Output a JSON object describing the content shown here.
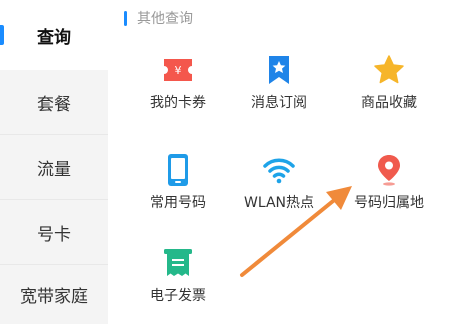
{
  "sidebar": {
    "items": [
      {
        "label": "查询"
      },
      {
        "label": "套餐"
      },
      {
        "label": "流量"
      },
      {
        "label": "号卡"
      },
      {
        "label": "宽带家庭"
      }
    ]
  },
  "main": {
    "section_title": "其他查询",
    "items": [
      {
        "label": "我的卡券",
        "icon": "coupon-icon"
      },
      {
        "label": "消息订阅",
        "icon": "bookmark-star-icon"
      },
      {
        "label": "商品收藏",
        "icon": "star-icon"
      },
      {
        "label": "常用号码",
        "icon": "phone-icon"
      },
      {
        "label": "WLAN热点",
        "icon": "wifi-icon"
      },
      {
        "label": "号码归属地",
        "icon": "location-pin-icon"
      },
      {
        "label": "电子发票",
        "icon": "invoice-icon"
      }
    ]
  },
  "colors": {
    "accent": "#1a8cff",
    "arrow": "#f08a3a",
    "coupon": "#f4574c",
    "bookmark": "#1f84e8",
    "star": "#f6b52a",
    "phone": "#1f9be8",
    "wifi": "#1ea3e8",
    "pin": "#f05a4d",
    "invoice": "#24b88a"
  }
}
